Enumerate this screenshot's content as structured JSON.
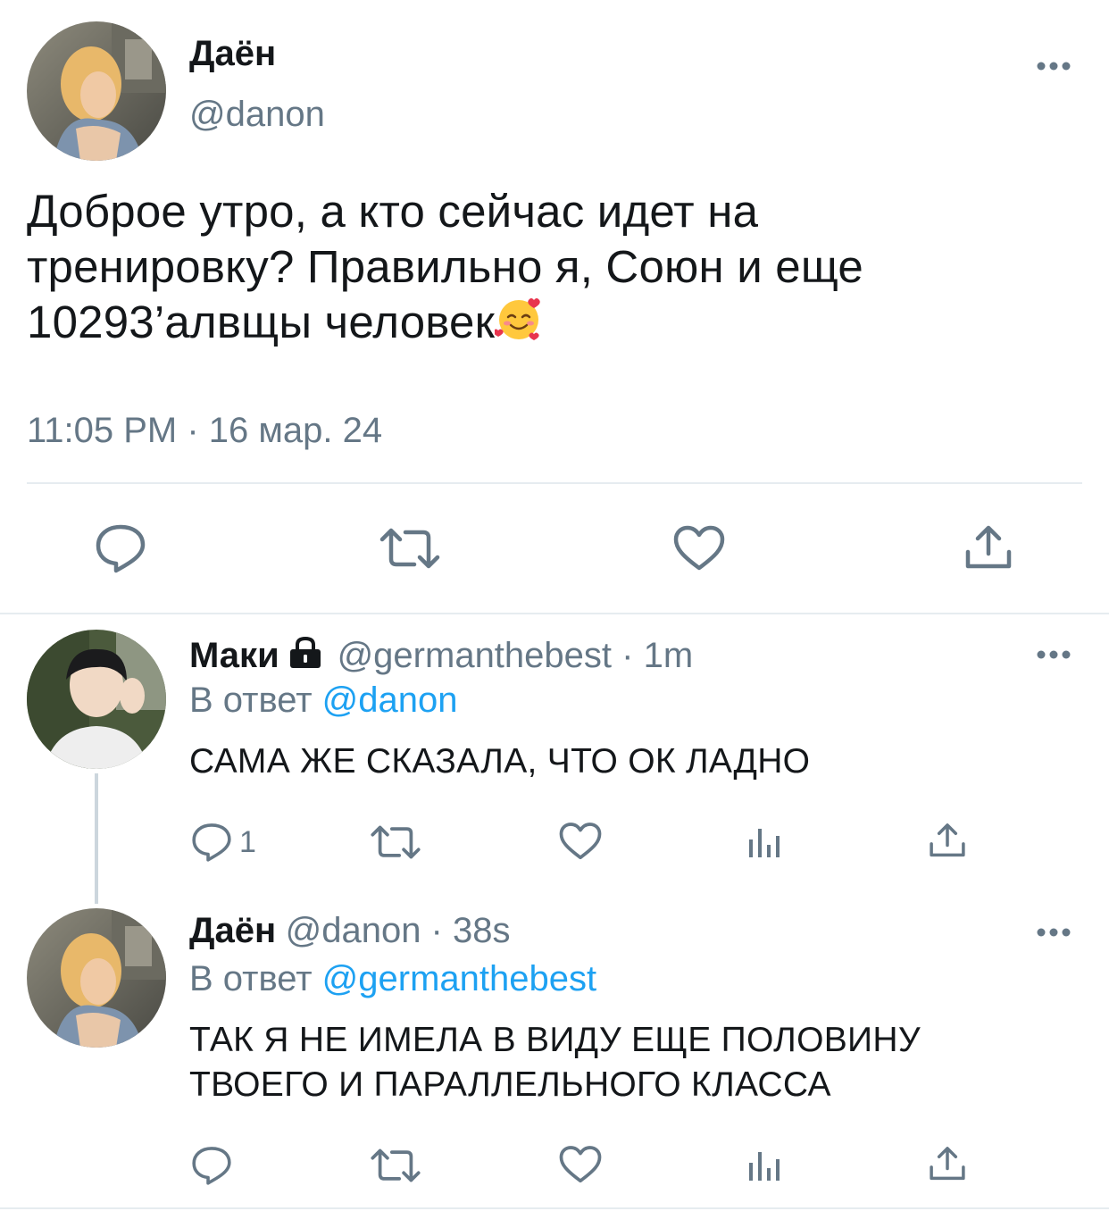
{
  "main_tweet": {
    "display_name": "Даён",
    "handle": "@danon",
    "text_line1": "Доброе утро, а кто сейчас идет на",
    "text_line2": "тренировку? Правильно я, Союн и еще",
    "text_line3": "10293’алвщы человек",
    "emoji": "smiling-face-with-hearts",
    "timestamp": "11:05 PM · 16 мар. 24"
  },
  "reply1": {
    "display_name": "Маки",
    "handle_time": "@germanthebest · 1m",
    "reply_prefix": "В ответ",
    "reply_to": "@danon",
    "text": "САМА ЖЕ СКАЗАЛА, ЧТО ОК ЛАДНО",
    "reply_count": "1"
  },
  "reply2": {
    "display_name": "Даён",
    "handle_time": "@danon · 38s",
    "reply_prefix": "В ответ",
    "reply_to": "@germanthebest",
    "text_line1": "ТАК Я НЕ ИМЕЛА В ВИДУ ЕЩЕ ПОЛОВИНУ",
    "text_line2": "ТВОЕГО И ПАРАЛЛЕЛЬНОГО КЛАССА"
  },
  "colors": {
    "text": "#14171a",
    "secondary": "#657786",
    "link": "#1da1f2",
    "divider": "#e6ecf0"
  }
}
